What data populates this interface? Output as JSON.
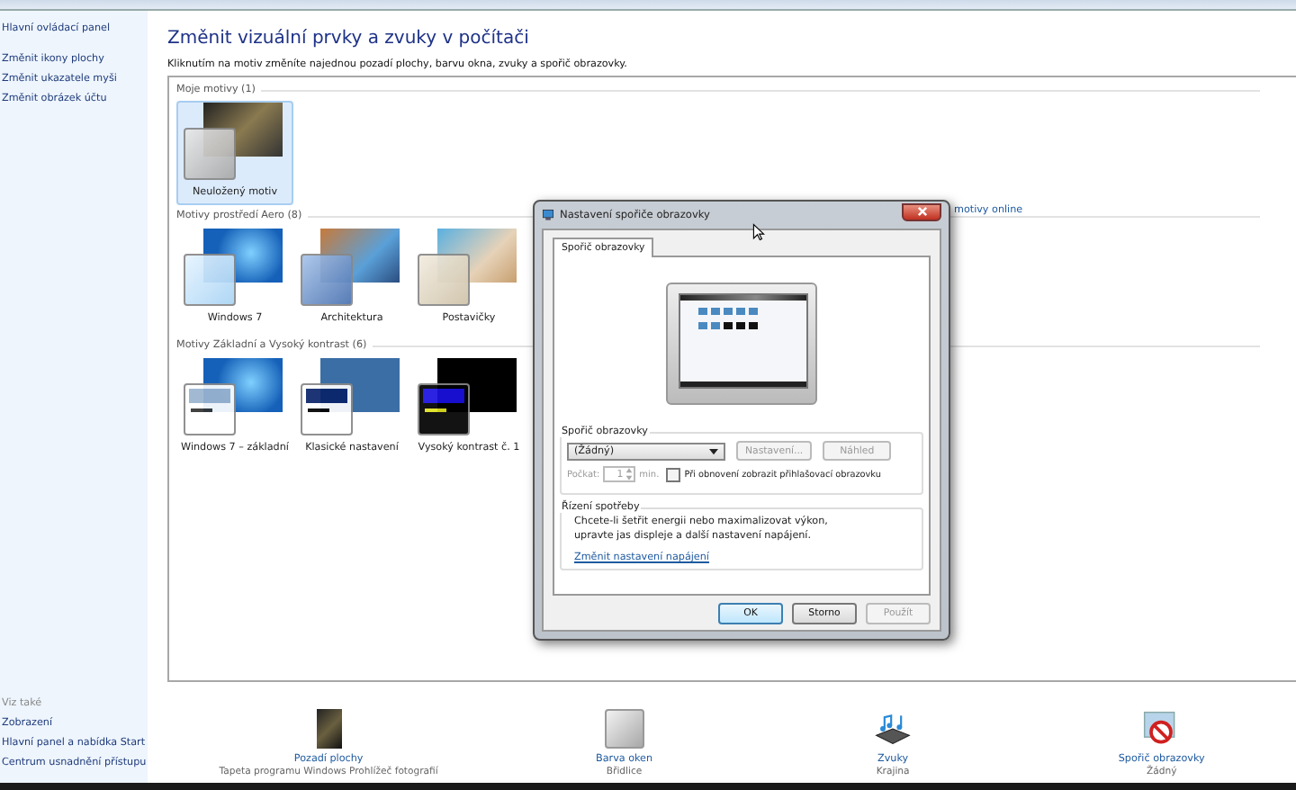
{
  "sidebar": {
    "home_link": "Hlavní ovládací panel",
    "links": [
      "Změnit ikony plochy",
      "Změnit ukazatele myši",
      "Změnit obrázek účtu"
    ],
    "see_also": {
      "heading": "Viz také",
      "links": [
        "Zobrazení",
        "Hlavní panel a nabídka Start",
        "Centrum usnadnění přístupu"
      ]
    }
  },
  "page": {
    "title": "Změnit vizuální prvky a zvuky v počítači",
    "subtitle": "Kliknutím na motiv změníte najednou pozadí plochy, barvu okna, zvuky a spořič obrazovky."
  },
  "theme_groups": [
    {
      "heading": "Moje motivy (1)",
      "themes": [
        {
          "name": "Neuložený motiv",
          "kind": "photo",
          "selected": true
        }
      ],
      "link": "motivy online"
    },
    {
      "heading": "Motivy prostředí Aero (8)",
      "themes": [
        {
          "name": "Windows 7",
          "kind": "win7",
          "selected": false
        },
        {
          "name": "Architektura",
          "kind": "architecture",
          "selected": false
        },
        {
          "name": "Postavičky",
          "kind": "characters",
          "selected": false
        }
      ]
    },
    {
      "heading": "Motivy Základní a Vysoký kontrast (6)",
      "themes": [
        {
          "name": "Windows 7 – základní",
          "kind": "basic",
          "selected": false
        },
        {
          "name": "Klasické nastavení",
          "kind": "classic",
          "selected": false
        },
        {
          "name": "Vysoký kontrast č. 1",
          "kind": "contrast",
          "selected": false
        }
      ]
    }
  ],
  "customizations": [
    {
      "label": "Pozadí plochy",
      "value": "Tapeta programu Windows Prohlížeč fotografií",
      "kind": "wallpaper"
    },
    {
      "label": "Barva oken",
      "value": "Břidlice",
      "kind": "color"
    },
    {
      "label": "Zvuky",
      "value": "Krajina",
      "kind": "sounds"
    },
    {
      "label": "Spořič obrazovky",
      "value": "Žádný",
      "kind": "screensaver"
    }
  ],
  "dialog": {
    "title": "Nastavení spořiče obrazovky",
    "tabs": [
      {
        "label": "Spořič obrazovky",
        "selected": true
      }
    ],
    "saver_group": {
      "heading": "Spořič obrazovky",
      "select_value": "(Žádný)",
      "settings_button": {
        "label": "Nastavení...",
        "disabled": true
      },
      "preview_button": {
        "label": "Náhled",
        "disabled": true
      },
      "wait_label": "Počkat:",
      "wait_value": "1",
      "wait_disabled": true,
      "unit": "min.",
      "logon_checkbox": {
        "label": "Při obnovení zobrazit přihlašovací obrazovku",
        "checked": false
      }
    },
    "power_group": {
      "heading": "Řízení spotřeby",
      "text": "Chcete-li šetřit energii nebo maximalizovat výkon, upravte jas displeje a další nastavení napájení.",
      "link": "Změnit nastavení napájení"
    },
    "buttons": [
      {
        "label": "OK",
        "default": true,
        "disabled": false
      },
      {
        "label": "Storno",
        "default": false,
        "disabled": false
      },
      {
        "label": "Použít",
        "default": false,
        "disabled": true
      }
    ]
  }
}
